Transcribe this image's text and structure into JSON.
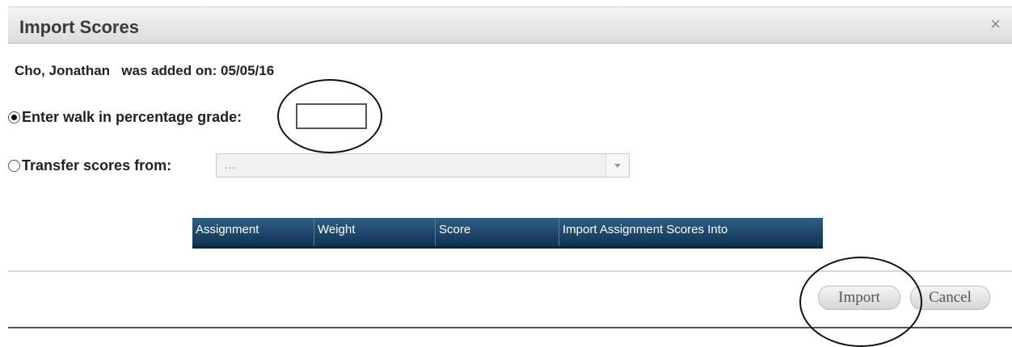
{
  "dialog": {
    "title": "Import Scores",
    "close_glyph": "×"
  },
  "student_line": "Cho, Jonathan   was added on: 05/05/16",
  "options": {
    "walk_in": {
      "label": "Enter walk in percentage grade:",
      "selected": true,
      "input_value": ""
    },
    "transfer": {
      "label": "Transfer scores from:",
      "selected": false,
      "select_value": "..."
    }
  },
  "table": {
    "columns": [
      "Assignment",
      "Weight",
      "Score",
      "Import Assignment Scores Into"
    ]
  },
  "buttons": {
    "import": "Import",
    "cancel": "Cancel"
  },
  "colors": {
    "table_header": "#0f3455",
    "annotation": "#111111"
  }
}
